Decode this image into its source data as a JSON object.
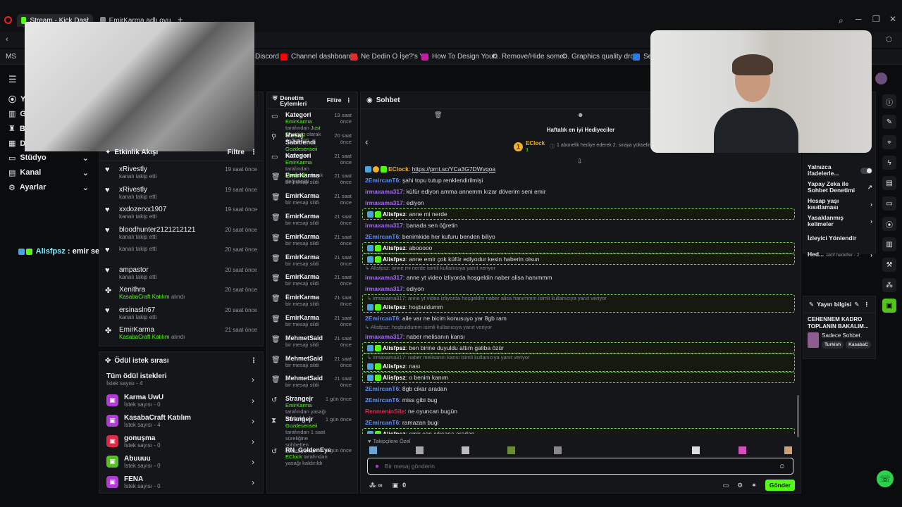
{
  "browser": {
    "tabs": [
      {
        "label": "Stream - Kick Dashboard",
        "active": true
      },
      {
        "label": "EmirKarma adlı oyuncunu",
        "active": false
      }
    ],
    "new_tab": "+",
    "bookmarks": [
      {
        "label": "MS",
        "color": "#5a5f66"
      },
      {
        "label": "Discord",
        "color": "#5865f2"
      },
      {
        "label": "Channel dashboard...",
        "color": "#ff0000"
      },
      {
        "label": "Ne Dedin O İşe?'s Y...",
        "color": "#e52b2b"
      },
      {
        "label": "How To Design Your...",
        "color": "#c41ea5"
      },
      {
        "label": "Remove/Hide some...",
        "color": "#9aa0a6"
      },
      {
        "label": "Graphics quality dro...",
        "color": "#9aa0a6"
      },
      {
        "label": "Se",
        "color": "#2c7be5"
      }
    ]
  },
  "leftnav": {
    "items": [
      {
        "label": "Yı",
        "icon": "broadcast-icon"
      },
      {
        "label": "G",
        "icon": "analytics-icon"
      },
      {
        "label": "B",
        "icon": "trophy-icon"
      },
      {
        "label": "D",
        "icon": "calendar-icon"
      },
      {
        "label": "Stüdyo",
        "icon": "studio-icon"
      },
      {
        "label": "Kanal",
        "icon": "channel-icon"
      },
      {
        "label": "Ayarlar",
        "icon": "gear-icon"
      }
    ],
    "overlay_message": {
      "user": "Alisfpsz",
      "text": " : emir sen çıksana aradan"
    }
  },
  "activity": {
    "title": "Etkinlik Akışı",
    "filter": "Filtre",
    "rows": [
      {
        "user": "xRivestly",
        "sub": "kanalı takip etti",
        "time": "19 saat önce",
        "icon": "heart"
      },
      {
        "user": "xRivestly",
        "sub": "kanalı takip etti",
        "time": "19 saat önce",
        "icon": "heart"
      },
      {
        "user": "xxdozerxx1907",
        "sub": "kanalı takip etti",
        "time": "19 saat önce",
        "icon": "heart"
      },
      {
        "user": "bloodhunter2121212121",
        "sub": "kanalı takip etti",
        "time": "20 saat önce",
        "icon": "heart"
      },
      {
        "user": "",
        "sub": "kanalı takip etti",
        "time": "20 saat önce",
        "icon": "heart"
      },
      {
        "user": "ampastor",
        "sub": "kanalı takip etti",
        "time": "20 saat önce",
        "icon": "heart"
      },
      {
        "user": "Xenithra",
        "sub": "KasabaCraft Katılım",
        "sub2": " alındı",
        "time": "20 saat önce",
        "icon": "reward"
      },
      {
        "user": "ersinasln67",
        "sub": "kanalı takip etti",
        "time": "20 saat önce",
        "icon": "heart"
      },
      {
        "user": "EmirKarma",
        "sub": "KasabaCraft Katılım",
        "sub2": " alındı",
        "time": "21 saat önce",
        "icon": "reward"
      }
    ]
  },
  "rewards": {
    "title": "Ödül istek sırası",
    "all": {
      "label": "Tüm ödül istekleri",
      "count": "İstek sayısı - 4"
    },
    "items": [
      {
        "name": "Karma UwU",
        "count": "İstek sayısı - 0",
        "color": "#b13bd6"
      },
      {
        "name": "KasabaCraft Katılım",
        "count": "İstek sayısı - 4",
        "color": "#b13bd6"
      },
      {
        "name": "gonuşma",
        "count": "İstek sayısı - 0",
        "color": "#e0284a"
      },
      {
        "name": "Abuuuu",
        "count": "İstek sayısı - 0",
        "color": "#53c41a"
      },
      {
        "name": "FENA",
        "count": "İstek sayısı - 0",
        "color": "#b13bd6"
      }
    ]
  },
  "moderation": {
    "title": "Denetim Eylemleri",
    "filter": "Filtre",
    "rows": [
      {
        "title": "Kategori",
        "l1g": "EmirKarma",
        "l1": " tarafından ",
        "l1b": "Just Chatting",
        "l2": " olarak değiştirildi",
        "time": "19 saat önce",
        "icon": "card"
      },
      {
        "title": "Mesaj Sabitlendi",
        "l1g": "Gozdesenseii",
        "l1": " tarafından",
        "l1b": "",
        "l2": "",
        "time": "20 saat önce",
        "icon": "pin"
      },
      {
        "title": "Kategori",
        "l1g": "EmirKarma",
        "l1": " tarafından ",
        "l1b": "Minecraft",
        "l2": " olarak değiştirildi",
        "time": "21 saat önce",
        "icon": "card"
      },
      {
        "title": "EmirKarma",
        "l1g": "",
        "l1": "bir mesajı sildi",
        "l1b": "",
        "l2": "",
        "time": "21 saat önce",
        "icon": "trash"
      },
      {
        "title": "EmirKarma",
        "l1g": "",
        "l1": "bir mesajı sildi",
        "l1b": "",
        "l2": "",
        "time": "21 saat önce",
        "icon": "trash"
      },
      {
        "title": "EmirKarma",
        "l1g": "",
        "l1": "bir mesajı sildi",
        "l1b": "",
        "l2": "",
        "time": "21 saat önce",
        "icon": "trash"
      },
      {
        "title": "EmirKarma",
        "l1g": "",
        "l1": "bir mesajı sildi",
        "l1b": "",
        "l2": "",
        "time": "21 saat önce",
        "icon": "trash"
      },
      {
        "title": "EmirKarma",
        "l1g": "",
        "l1": "bir mesajı sildi",
        "l1b": "",
        "l2": "",
        "time": "21 saat önce",
        "icon": "trash"
      },
      {
        "title": "EmirKarma",
        "l1g": "",
        "l1": "bir mesajı sildi",
        "l1b": "",
        "l2": "",
        "time": "21 saat önce",
        "icon": "trash"
      },
      {
        "title": "EmirKarma",
        "l1g": "",
        "l1": "bir mesajı sildi",
        "l1b": "",
        "l2": "",
        "time": "21 saat önce",
        "icon": "trash"
      },
      {
        "title": "EmirKarma",
        "l1g": "",
        "l1": "bir mesajı sildi",
        "l1b": "",
        "l2": "",
        "time": "21 saat önce",
        "icon": "trash"
      },
      {
        "title": "MehmetSaid",
        "l1g": "",
        "l1": "bir mesajı sildi",
        "l1b": "",
        "l2": "",
        "time": "21 saat önce",
        "icon": "trash"
      },
      {
        "title": "MehmetSaid",
        "l1g": "",
        "l1": "bir mesajı sildi",
        "l1b": "",
        "l2": "",
        "time": "21 saat önce",
        "icon": "trash"
      },
      {
        "title": "MehmetSaid",
        "l1g": "",
        "l1": "bir mesajı sildi",
        "l1b": "",
        "l2": "",
        "time": "21 saat önce",
        "icon": "trash"
      },
      {
        "title": "Strangejr",
        "l1g": "EmirKarma",
        "l1": " tarafından yasağı kaldırıldı",
        "l1b": "",
        "l2": "",
        "time": "1 gün önce",
        "icon": "undo"
      },
      {
        "title": "Strangejr",
        "l1g": "Gozdesenseii",
        "l1": " tarafından 1 saat süreliğine sohbetten uzaklaştırıldı",
        "l1b": "",
        "l2": "",
        "time": "1 gün önce",
        "icon": "hourglass"
      },
      {
        "title": "RN_GoldenEye",
        "l1g": "EClock",
        "l1": " tarafından yasağı kaldırıldı",
        "l1b": "",
        "l2": "",
        "time": "1 gün önce",
        "icon": "undo"
      }
    ]
  },
  "chat": {
    "title": "Sohbet",
    "gifters_title": "Haftalık en iyi Hediyeciler",
    "gifter_name": "EClock",
    "gifter_count": "1",
    "gifter_hint": "1 abonelik hediye ederek 2. sıraya yükselin",
    "messages": [
      {
        "type": "msg",
        "user": "EClock",
        "color": "#f2b01e",
        "text": ": ",
        "link": "https://prnt.sc/YCa3G7DWvqoa",
        "badges": [
          "b",
          "y",
          "g"
        ]
      },
      {
        "type": "msg",
        "user": "2EmircanT6",
        "color": "#5b8cff",
        "text": ": şahi topu tutup renklendirilmişi"
      },
      {
        "type": "msg",
        "user": "irmaxama317",
        "color": "#a866ff",
        "text": ": küfür ediyon amma annemm kızar döverim seni emir"
      },
      {
        "type": "msg",
        "user": "irmaxama317",
        "color": "#a866ff",
        "text": ": ediyon"
      },
      {
        "type": "hl",
        "user": "Alisfpsz",
        "color": "#ffffff",
        "text": ": anne mi nerde"
      },
      {
        "type": "msg",
        "user": "irmaxama317",
        "color": "#a866ff",
        "text": ": banada sen öğretin"
      },
      {
        "type": "msg",
        "user": "2EmircanT6",
        "color": "#5b8cff",
        "text": ": benimkide her kufuru benden biliyo"
      },
      {
        "type": "hl",
        "user": "Alisfpsz",
        "color": "#ffffff",
        "text": ": abooooo"
      },
      {
        "type": "hl",
        "user": "Alisfpsz",
        "color": "#ffffff",
        "text": ": anne emir çok küfür ediyodur kesin haberin olsun"
      },
      {
        "type": "reply",
        "text": "↳ Alisfpsz: anne mi nerde isimli kullanıcıya yanıt veriyor"
      },
      {
        "type": "msg",
        "user": "irmaxama317",
        "color": "#a866ff",
        "text": ": anne yt video izliyorda hoşgeldin naber alisa hanımmm"
      },
      {
        "type": "msg",
        "user": "irmaxama317",
        "color": "#a866ff",
        "text": ": ediyon"
      },
      {
        "type": "hlreply",
        "reply": "↳ irmaxama317: anne yt video izliyorda hoşgeldin naber alisa hanımmm  isimli kullanıcıya yanıt veriyor",
        "user": "Alisfpsz",
        "color": "#ffffff",
        "text": ": hoşbuldumm"
      },
      {
        "type": "msg",
        "user": "2EmircanT6",
        "color": "#5b8cff",
        "text": ": aile var ne bicim konusuyo yar 8gb ram"
      },
      {
        "type": "reply",
        "text": "↳ Alisfpsz: hoşbuldumm isimli kullanıcıya yanıt veriyor"
      },
      {
        "type": "msg",
        "user": "irmaxama317",
        "color": "#a866ff",
        "text": ": naber melisanın kansı"
      },
      {
        "type": "hl",
        "user": "Alisfpsz",
        "color": "#ffffff",
        "text": ": ben birine duyuldu attım galiba özür"
      },
      {
        "type": "hlreply",
        "reply": "↳ irmaxama317: naber melisanın kansı isimli kullanıcıya yanıt veriyor",
        "user": "Alisfpsz",
        "color": "#ffffff",
        "text": ": nası"
      },
      {
        "type": "hl",
        "user": "Alisfpsz",
        "color": "#ffffff",
        "text": ": o benim kanım"
      },
      {
        "type": "msg",
        "user": "2EmircanT6",
        "color": "#5b8cff",
        "text": ": 8gb cikar aradan"
      },
      {
        "type": "msg",
        "user": "2EmircanT6",
        "color": "#5b8cff",
        "text": ": miss gibi bug"
      },
      {
        "type": "msg",
        "user": "RenmeninSile",
        "color": "#e0284a",
        "text": ": ne oyuncan bugün"
      },
      {
        "type": "msg",
        "user": "2EmircanT6",
        "color": "#5b8cff",
        "text": ": ramazan bugi"
      },
      {
        "type": "hl",
        "user": "Alisfpsz",
        "color": "#ffffff",
        "text": ": emir sen çıksana aradan"
      }
    ],
    "followers_only": "Takipçilere Özel",
    "input_placeholder": "Bir mesaj gönderin",
    "points": "0",
    "infinity": "∞",
    "send": "Gönder"
  },
  "settings": {
    "rows": [
      {
        "label": "Yalnızca ifadelerle...",
        "kind": "toggle"
      },
      {
        "label": "Yapay Zeka ile Sohbet Denetimi",
        "kind": "external"
      },
      {
        "label": "Hesap yaşı kısıtlaması",
        "kind": "chevron"
      },
      {
        "label": "Yasaklanmış kelimeler",
        "kind": "chevron"
      },
      {
        "label": "İzleyici Yönlendir",
        "kind": "none"
      },
      {
        "label": "Hed...",
        "sub": "Aktif hedefler - 2",
        "kind": "chevron"
      }
    ]
  },
  "stream_info": {
    "title": "Yayın bilgisi",
    "stream_title": "CEHENNEM KADRO TOPLANIN BAKALIM...",
    "category": "Sadece Sohbet",
    "tags": [
      "Turkish",
      "KasabaC"
    ]
  },
  "colors": {
    "accent": "#53fc18",
    "bg": "#0b0c0e",
    "panel": "#151619"
  }
}
